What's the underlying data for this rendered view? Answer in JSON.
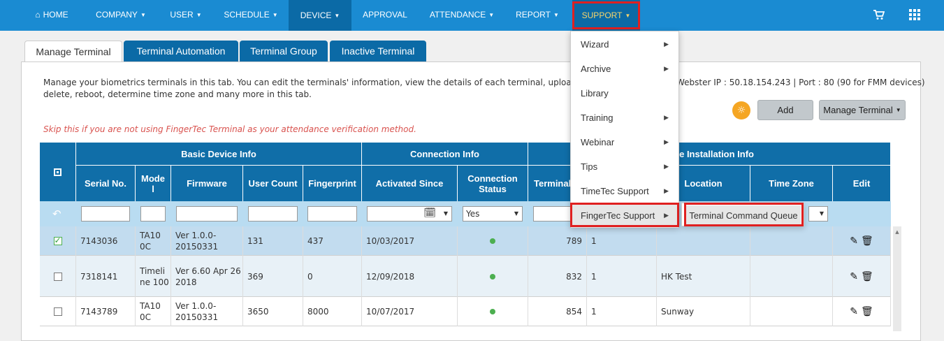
{
  "navbar": {
    "items": [
      {
        "label": "HOME",
        "icon": "home-icon"
      },
      {
        "label": "COMPANY"
      },
      {
        "label": "USER"
      },
      {
        "label": "SCHEDULE"
      },
      {
        "label": "DEVICE"
      },
      {
        "label": "APPROVAL"
      },
      {
        "label": "ATTENDANCE"
      },
      {
        "label": "REPORT"
      },
      {
        "label": "SUPPORT"
      }
    ],
    "cart_icon": "cart-icon",
    "apps_icon": "grid-icon"
  },
  "tabs": [
    "Manage Terminal",
    "Terminal Automation",
    "Terminal Group",
    "Inactive Terminal"
  ],
  "panel": {
    "description_line1": "Manage your biometrics terminals in this tab. You can edit the terminals' information, view the details of each terminal, upload, do",
    "description_line2": "delete, reboot, determine time zone and many more in this tab.",
    "ip_info": "Webster IP : 50.18.154.243 | Port : 80 (90 for FMM devices)",
    "warning": "Skip this if you are not using FingerTec Terminal as your attendance verification method.",
    "add_label": "Add",
    "manage_label": "Manage Terminal"
  },
  "table": {
    "groups": [
      "Basic Device Info",
      "Connection Info",
      "ce Installation Info"
    ],
    "columns": [
      "Serial No.",
      "Mode l",
      "Firmware",
      "User Count",
      "Fingerprint",
      "Activated Since",
      "Connection Status",
      "Terminal",
      "Location",
      "Time Zone",
      "Edit"
    ],
    "filter_status": "Yes",
    "rows": [
      {
        "serial": "7143036",
        "model": "TA10 0C",
        "firmware": "Ver 1.0.0-20150331",
        "users": "131",
        "fingerprint": "437",
        "activated": "10/03/2017",
        "terminal": "789",
        "t2": "1",
        "location": "",
        "checked": true
      },
      {
        "serial": "7318141",
        "model": "Timeli ne 100",
        "firmware": "Ver 6.60 Apr 26 2018",
        "users": "369",
        "fingerprint": "0",
        "activated": "12/09/2018",
        "terminal": "832",
        "t2": "1",
        "location": "HK Test",
        "checked": false
      },
      {
        "serial": "7143789",
        "model": "TA10 0C",
        "firmware": "Ver 1.0.0-20150331",
        "users": "3650",
        "fingerprint": "8000",
        "activated": "10/07/2017",
        "terminal": "854",
        "t2": "1",
        "location": "Sunway",
        "checked": false
      }
    ]
  },
  "menu": {
    "items": [
      "Wizard",
      "Archive",
      "Library",
      "Training",
      "Webinar",
      "Tips",
      "TimeTec Support",
      "FingerTec Support"
    ],
    "submenu_item": "Terminal Command Queue"
  }
}
